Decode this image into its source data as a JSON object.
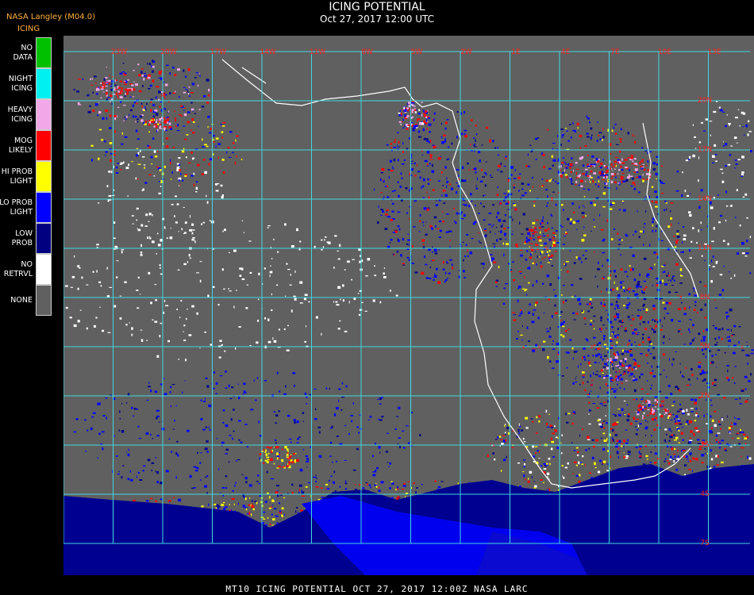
{
  "header": {
    "source": "NASA Langley (M04.0)",
    "product": "ICING",
    "title": "ICING POTENTIAL",
    "subtitle": "Oct 27, 2017 12:00 UTC"
  },
  "legend": [
    {
      "label_top": "NO",
      "label_bottom": "DATA",
      "color": "#00c000"
    },
    {
      "label_top": "NIGHT",
      "label_bottom": "ICING",
      "color": "#00f0f0"
    },
    {
      "label_top": "HEAVY",
      "label_bottom": "ICING",
      "color": "#f0a8e8"
    },
    {
      "label_top": "MOG",
      "label_bottom": "LIKELY",
      "color": "#ff0000"
    },
    {
      "label_top": "HI PROB",
      "label_bottom": "LIGHT",
      "color": "#ffff00"
    },
    {
      "label_top": "LO PROB",
      "label_bottom": "LIGHT",
      "color": "#0000ff"
    },
    {
      "label_top": "LOW",
      "label_bottom": "PROB",
      "color": "#000080"
    },
    {
      "label_top": "NO",
      "label_bottom": "RETRVL",
      "color": "#ffffff"
    },
    {
      "label_top": "NONE",
      "label_bottom": "",
      "color": "#606060"
    }
  ],
  "map": {
    "background": "#606060",
    "grid_color": "#40d8e0",
    "coast_color": "#ffffff",
    "top_labels": [
      "23W",
      "20W",
      "17W",
      "14W",
      "11W",
      "8W",
      "5W",
      "2W",
      "1E",
      "4E",
      "7E",
      "10E",
      "13E"
    ],
    "right_labels": [
      "20N",
      "17N",
      "14N",
      "11N",
      "8N",
      "5N",
      "2N",
      "1S",
      "4S",
      "7S",
      "10S"
    ]
  },
  "footer": "MT10  ICING POTENTIAL   OCT 27, 2017 12:00Z   NASA LARC"
}
